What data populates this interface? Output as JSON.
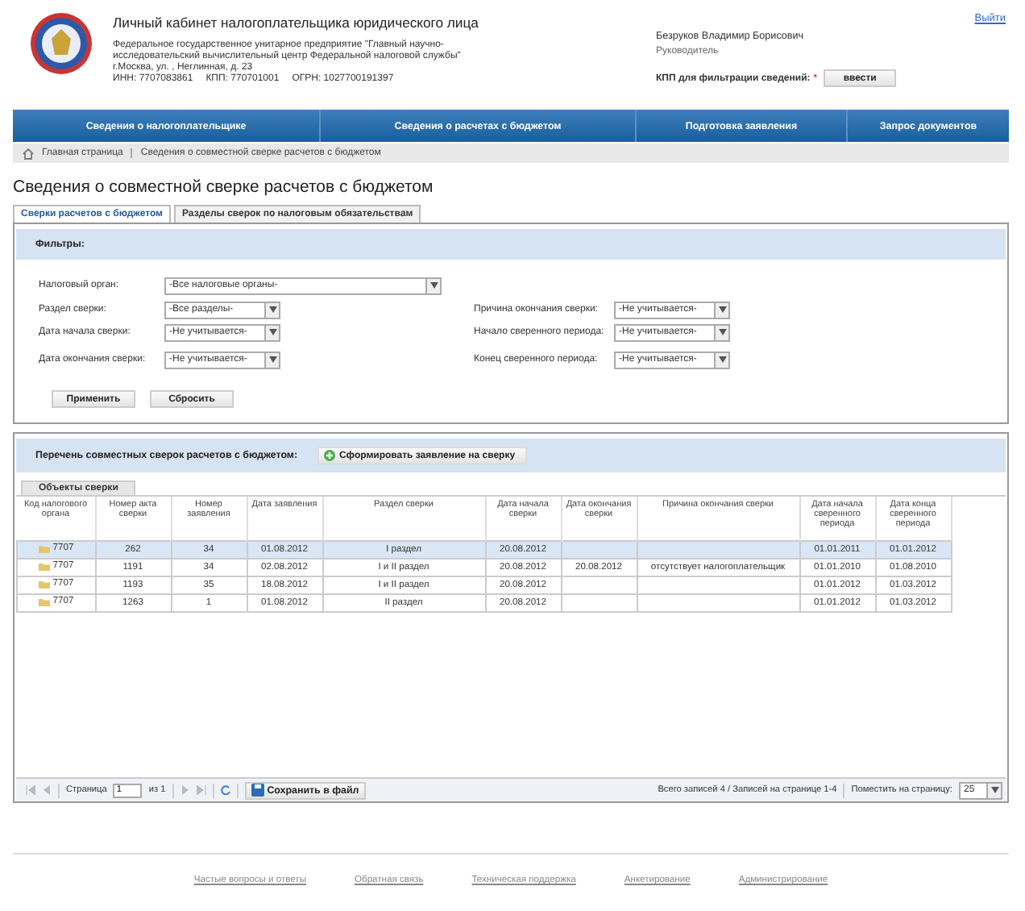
{
  "header": {
    "title": "Личный кабинет налогоплательщика юридического лица",
    "organization": "Федеральное государственное унитарное предприятие \"Главный научно-исследовательский вычислительный центр Федеральной налоговой службы\"",
    "address": "г.Москва, ул. , Неглинная, д. 23",
    "ids": [
      "ИНН: 7707083861",
      "КПП: 770701001",
      "ОГРН: 1027700191397"
    ],
    "user_name": "Безруков Владимир Борисович",
    "user_role": "Руководитель",
    "kpp_label": "КПП для фильтрации сведений:",
    "kpp_required_mark": "*",
    "kpp_button": "ввести",
    "logout": "Выйти"
  },
  "nav": [
    "Сведения о налогоплательщике",
    "Сведения о расчетах с бюджетом",
    "Подготовка заявления",
    "Запрос документов"
  ],
  "breadcrumbs": [
    "Главная страница",
    "Сведения о совместной сверке расчетов с бюджетом"
  ],
  "page_title": "Сведения о совместной сверке расчетов с бюджетом",
  "tabs": [
    {
      "label": "Сверки расчетов с бюджетом",
      "selected": true
    },
    {
      "label": "Разделы сверок по налоговым обязательствам",
      "selected": false
    }
  ],
  "filters": {
    "title": "Фильтры:",
    "wide": {
      "label": "Налоговый орган:",
      "value": "-Все налоговые органы-"
    },
    "left": [
      {
        "label": "Раздел сверки:",
        "value": "-Все разделы-"
      },
      {
        "label": "Дата начала сверки:",
        "value": "-Не учитывается-"
      },
      {
        "label": "Дата окончания сверки:",
        "value": "-Не учитывается-"
      }
    ],
    "right": [
      {
        "label": "Причина окончания сверки:",
        "value": "-Не учитывается-"
      },
      {
        "label": "Начало сверенного периода:",
        "value": "-Не учитывается-"
      },
      {
        "label": "Конец сверенного периода:",
        "value": "-Не учитывается-"
      }
    ],
    "buttons": [
      "Применить",
      "Сбросить"
    ]
  },
  "list": {
    "title": "Перечень совместных сверок расчетов с бюджетом:",
    "action": "Сформировать заявление на сверку",
    "subtab": "Объекты сверки",
    "table": {
      "columns": [
        "Код налогового органа",
        "Номер акта сверки",
        "Номер заявления",
        "Дата заявления",
        "Раздел сверки",
        "Дата начала сверки",
        "Дата окончания сверки",
        "Причина окончания сверки",
        "Дата начала сверенного периода",
        "Дата конца сверенного периода"
      ],
      "rows": [
        {
          "selected": true,
          "cells": [
            "7707",
            "262",
            "34",
            "01.08.2012",
            "I раздел",
            "20.08.2012",
            null,
            null,
            "01.01.2011",
            "01.01.2012"
          ]
        },
        {
          "selected": false,
          "cells": [
            "7707",
            "1191",
            "34",
            "02.08.2012",
            "I и II раздел",
            "20.08.2012",
            "20.08.2012",
            "отсутствует налогоплательщик",
            "01.01.2010",
            "01.08.2010"
          ]
        },
        {
          "selected": false,
          "cells": [
            "7707",
            "1193",
            "35",
            "18.08.2012",
            "I и II раздел",
            "20.08.2012",
            null,
            null,
            "01.01.2012",
            "01.03.2012"
          ]
        },
        {
          "selected": false,
          "cells": [
            "7707",
            "1263",
            "1",
            "01.08.2012",
            "II раздел",
            "20.08.2012",
            null,
            null,
            "01.01.2012",
            "01.03.2012"
          ]
        }
      ]
    },
    "pager": {
      "page_label": "Страница",
      "page": "1",
      "of": "из 1",
      "save": "Сохранить в файл",
      "summary": "Всего записей 4 / Записей на странице 1-4",
      "per_page_label": "Поместить на страницу:",
      "per_page": "25"
    }
  },
  "footer": [
    "Частые вопросы и ответы",
    "Обратная связь",
    "Техническая поддержка",
    "Анкетирование",
    "Администрирование"
  ]
}
